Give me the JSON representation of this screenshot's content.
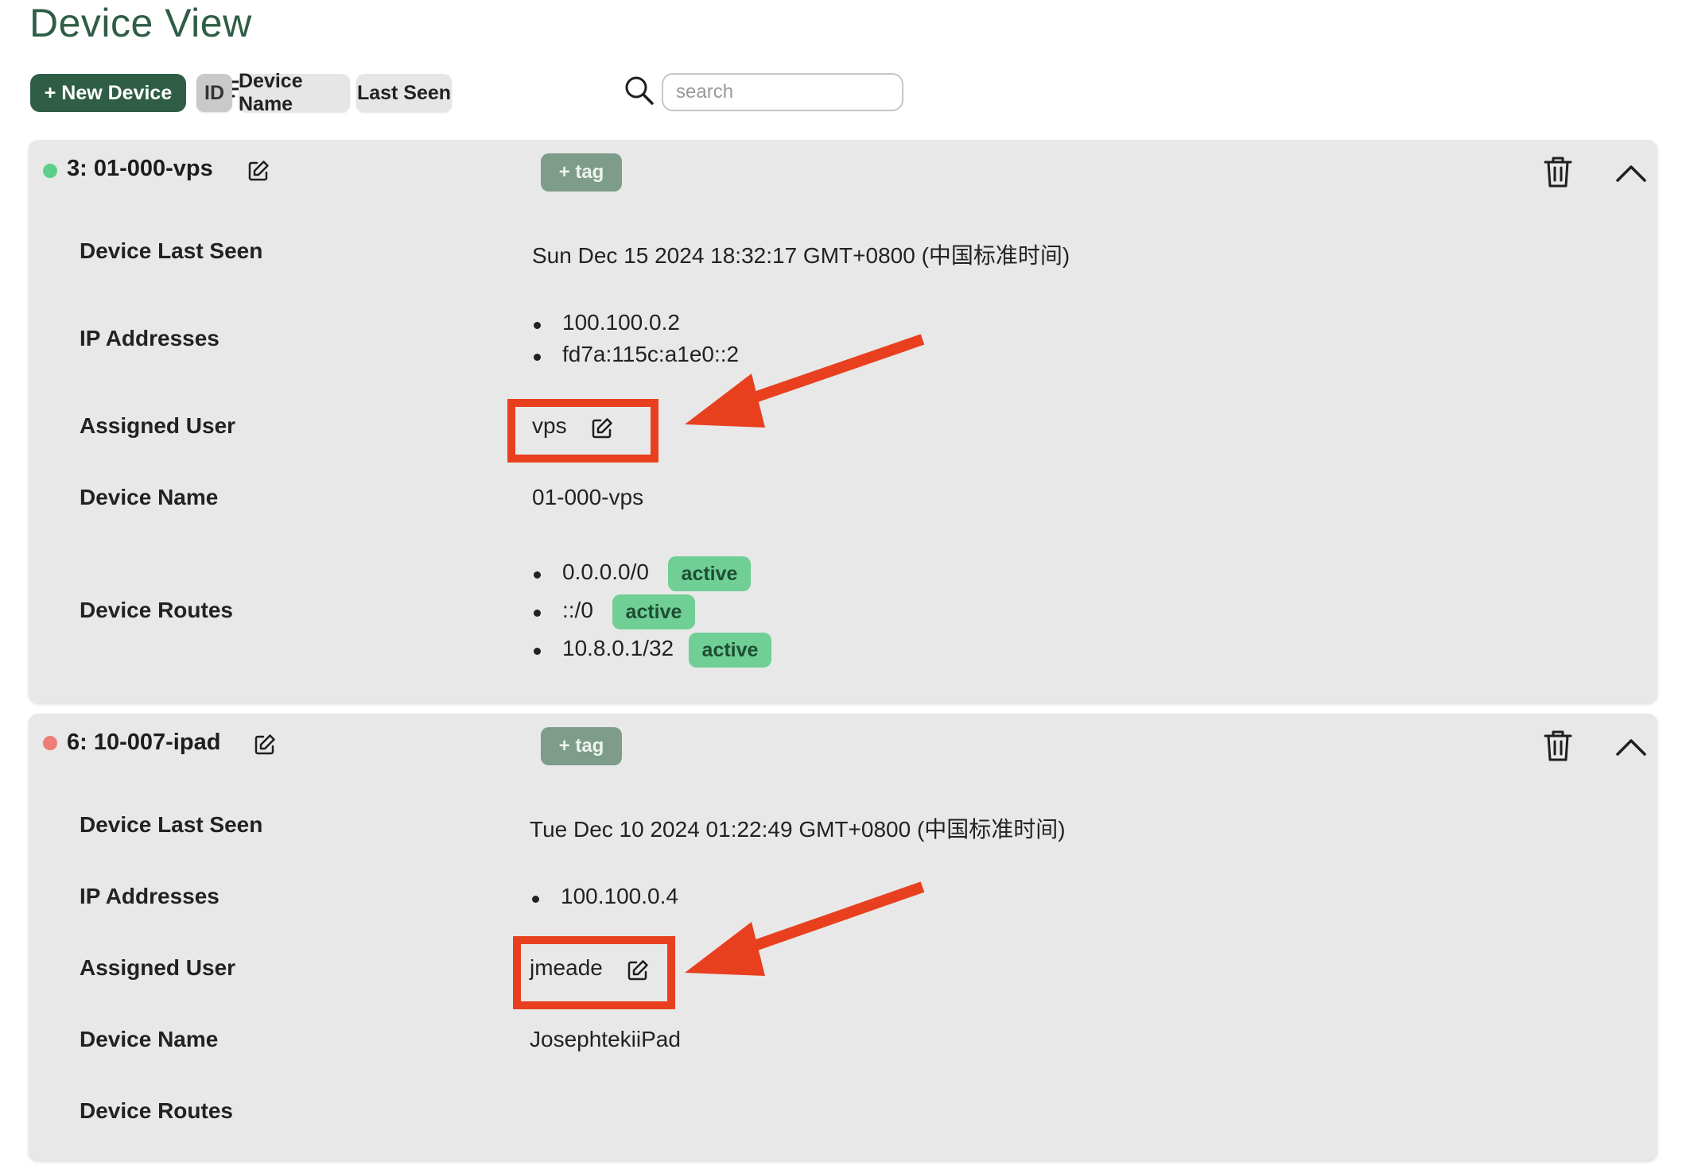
{
  "page": {
    "title": "Device View"
  },
  "toolbar": {
    "new_device_label": "+ New Device",
    "sort_options": [
      "ID",
      "Device Name",
      "Last Seen"
    ],
    "active_sort": "ID",
    "search_placeholder": "search"
  },
  "devices": [
    {
      "title": "3: 01-000-vps",
      "status": "online",
      "status_color": "#5ccf8b",
      "tag_label": "+ tag",
      "labels": {
        "last_seen": "Device Last Seen",
        "ips": "IP Addresses",
        "user": "Assigned User",
        "name": "Device Name",
        "routes": "Device Routes"
      },
      "last_seen": "Sun Dec 15 2024 18:32:17 GMT+0800 (中国标准时间)",
      "ip_addresses": [
        "100.100.0.2",
        "fd7a:115c:a1e0::2"
      ],
      "assigned_user": "vps",
      "device_name": "01-000-vps",
      "routes": [
        {
          "cidr": "0.0.0.0/0",
          "status": "active"
        },
        {
          "cidr": "::/0",
          "status": "active"
        },
        {
          "cidr": "10.8.0.1/32",
          "status": "active"
        }
      ]
    },
    {
      "title": "6: 10-007-ipad",
      "status": "offline",
      "status_color": "#ee7d78",
      "tag_label": "+ tag",
      "labels": {
        "last_seen": "Device Last Seen",
        "ips": "IP Addresses",
        "user": "Assigned User",
        "name": "Device Name",
        "routes": "Device Routes"
      },
      "last_seen": "Tue Dec 10 2024 01:22:49 GMT+0800 (中国标准时间)",
      "ip_addresses": [
        "100.100.0.4"
      ],
      "assigned_user": "jmeade",
      "device_name": "JosephtekiiPad",
      "routes": []
    }
  ],
  "colors": {
    "brand": "#2f5d45",
    "tag": "#7e9c8a",
    "route_badge": "#6fcf95",
    "annotation": "#e8401f"
  }
}
